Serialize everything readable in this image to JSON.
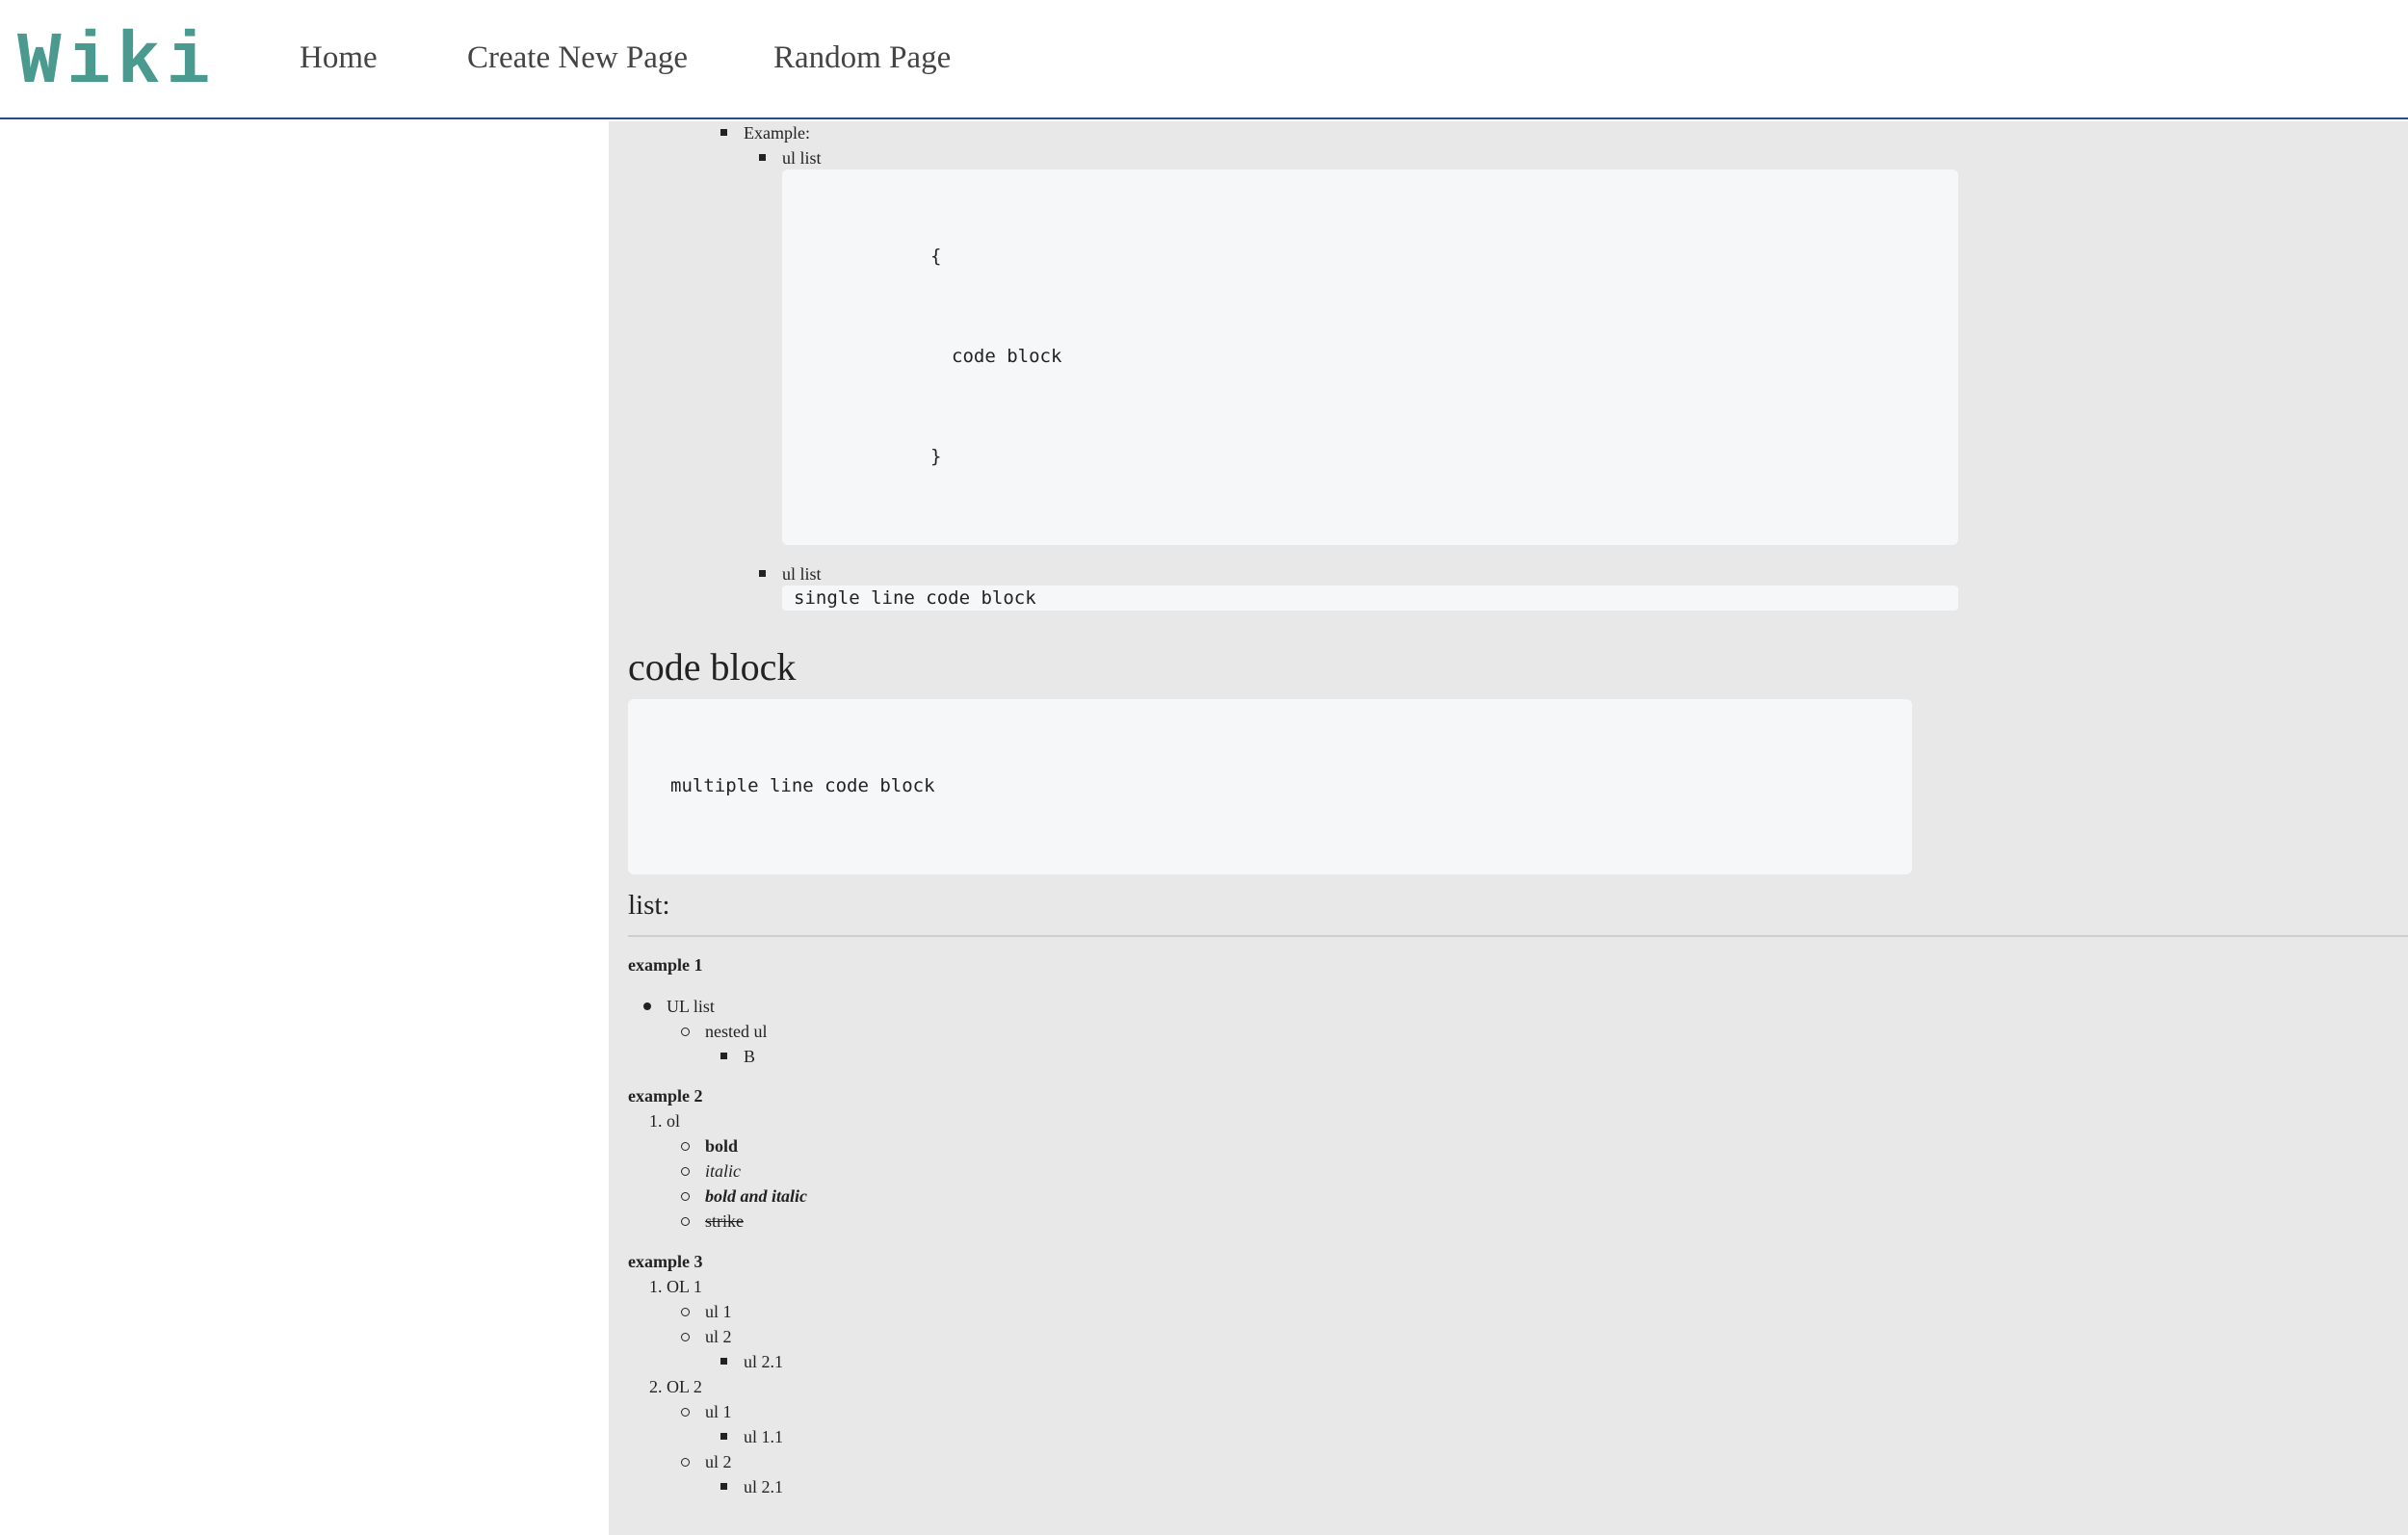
{
  "header": {
    "logo": "Wiki",
    "nav": [
      "Home",
      "Create New Page",
      "Random Page"
    ]
  },
  "content": {
    "example_label": "Example:",
    "ul_list_1": "ul list",
    "code_block_lines": [
      "{",
      "code block",
      "}"
    ],
    "ul_list_2": "ul list",
    "single_line_code": "single line code block",
    "code_block_heading": "code block",
    "multi_line_code": "multiple line code block",
    "list_heading": "list:",
    "example1": {
      "title": "example 1",
      "ul": "UL list",
      "nested": "nested ul",
      "leaf": "B"
    },
    "example2": {
      "title": "example 2",
      "ol": "1. ol",
      "bold": "bold",
      "italic": "italic",
      "bold_italic": "bold and italic",
      "strike": "strike"
    },
    "example3": {
      "title": "example 3",
      "ol1": "1. OL 1",
      "ol1_ul1": "ul 1",
      "ol1_ul2": "ul 2",
      "ol1_ul21": "ul 2.1",
      "ol2": "2. OL 2",
      "ol2_ul1": "ul 1",
      "ol2_ul11": "ul 1.1",
      "ol2_ul2": "ul 2",
      "ol2_ul21": "ul 2.1"
    }
  }
}
